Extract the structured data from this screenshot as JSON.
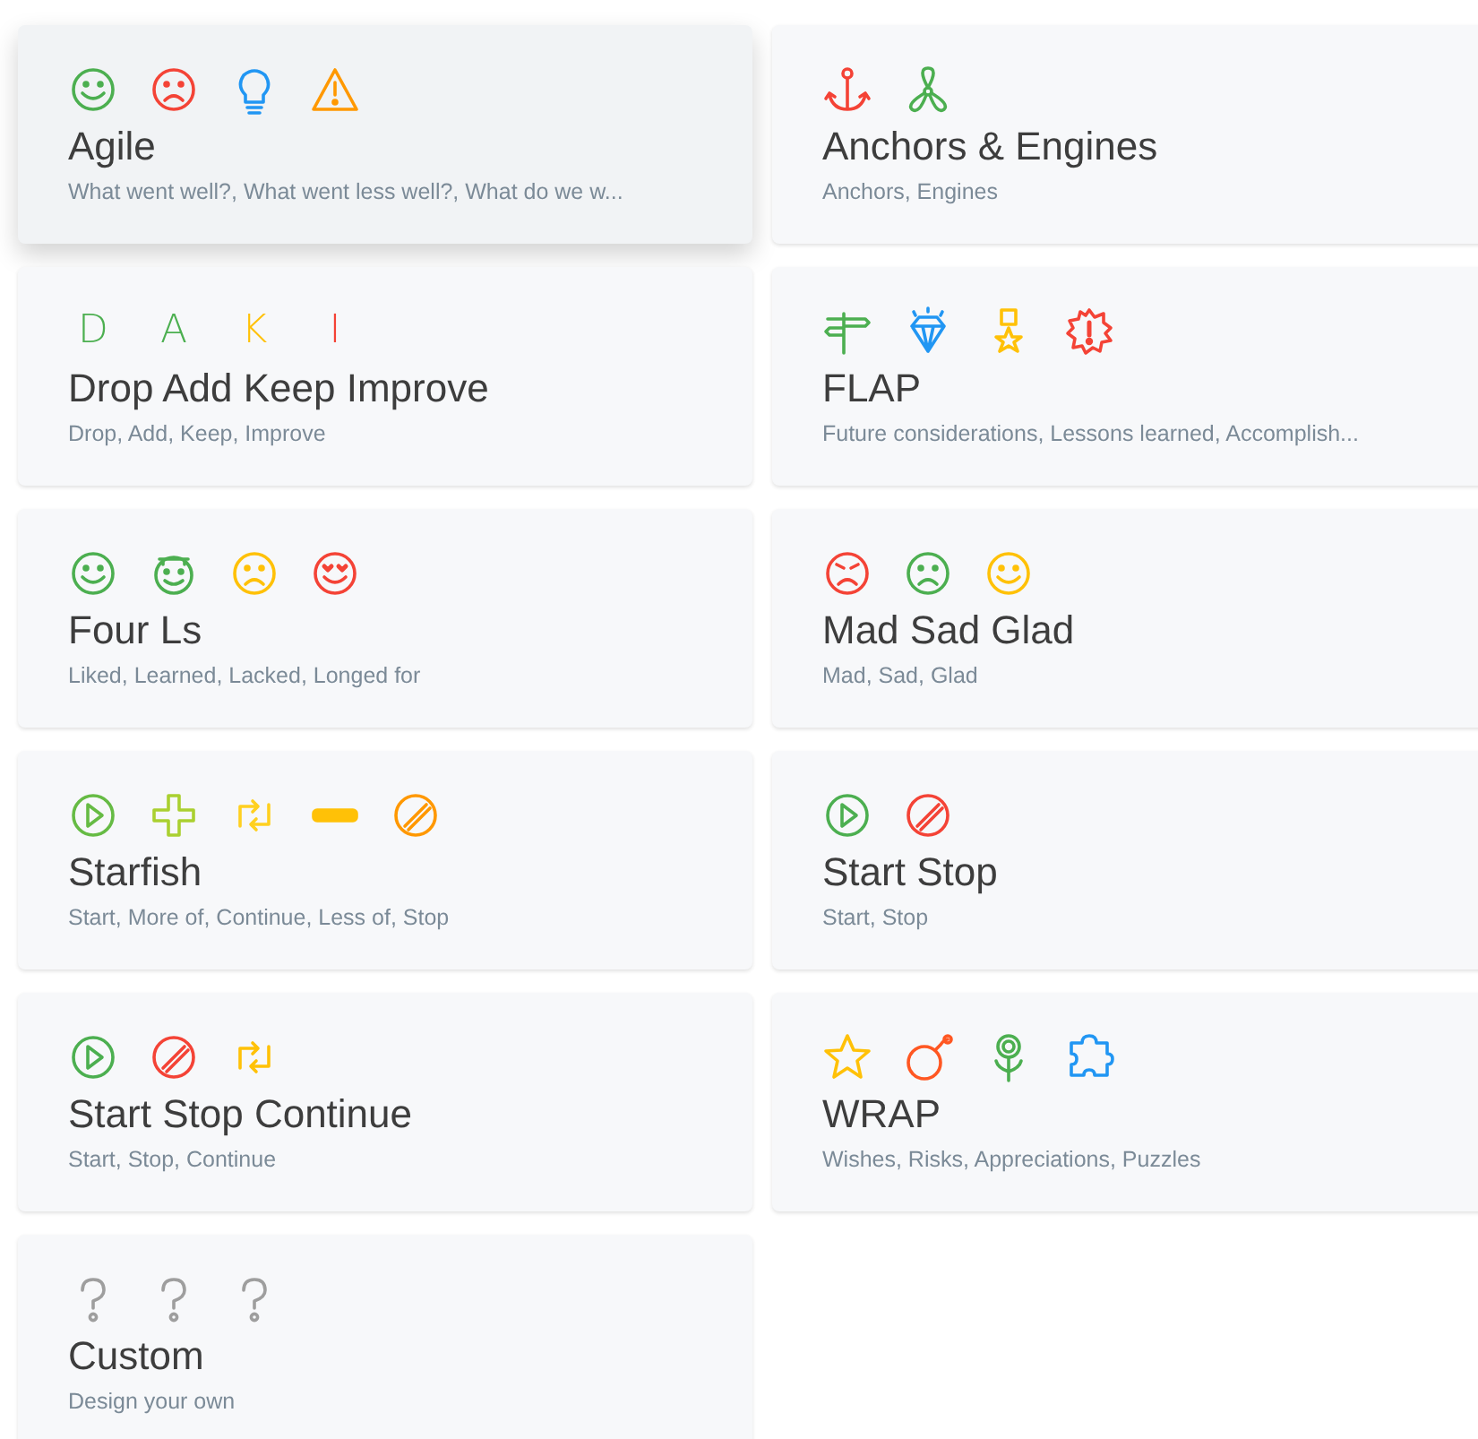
{
  "templates": [
    {
      "title": "Agile",
      "subtitle": "What went well?, What went less well?, What do we w...",
      "selected": true,
      "icons": [
        {
          "kind": "smile",
          "color": "#4caf50"
        },
        {
          "kind": "frown",
          "color": "#f44336"
        },
        {
          "kind": "bulb",
          "color": "#2196f3"
        },
        {
          "kind": "warning",
          "color": "#ff9800"
        }
      ]
    },
    {
      "title": "Anchors & Engines",
      "subtitle": "Anchors, Engines",
      "selected": false,
      "icons": [
        {
          "kind": "anchor",
          "color": "#f44336"
        },
        {
          "kind": "propeller",
          "color": "#4caf50"
        }
      ]
    },
    {
      "title": "Drop Add Keep Improve",
      "subtitle": "Drop, Add, Keep, Improve",
      "selected": false,
      "icons": [
        {
          "kind": "letter",
          "text": "D",
          "color": "#4caf50"
        },
        {
          "kind": "letter",
          "text": "A",
          "color": "#4caf50"
        },
        {
          "kind": "letter",
          "text": "K",
          "color": "#ffc107"
        },
        {
          "kind": "letter",
          "text": "I",
          "color": "#f44336"
        }
      ]
    },
    {
      "title": "FLAP",
      "subtitle": "Future considerations, Lessons learned, Accomplish...",
      "selected": false,
      "icons": [
        {
          "kind": "signpost",
          "color": "#4caf50"
        },
        {
          "kind": "diamond",
          "color": "#2196f3"
        },
        {
          "kind": "medal",
          "color": "#ffc107"
        },
        {
          "kind": "burst",
          "color": "#f44336"
        }
      ]
    },
    {
      "title": "Four Ls",
      "subtitle": "Liked, Learned, Lacked, Longed for",
      "selected": false,
      "icons": [
        {
          "kind": "smile",
          "color": "#4caf50"
        },
        {
          "kind": "graduate",
          "color": "#4caf50"
        },
        {
          "kind": "frown",
          "color": "#ffc107"
        },
        {
          "kind": "heart-eyes",
          "color": "#f44336"
        }
      ]
    },
    {
      "title": "Mad Sad Glad",
      "subtitle": "Mad, Sad, Glad",
      "selected": false,
      "icons": [
        {
          "kind": "angry",
          "color": "#f44336"
        },
        {
          "kind": "frown",
          "color": "#4caf50"
        },
        {
          "kind": "smile",
          "color": "#ffc107"
        }
      ]
    },
    {
      "title": "Starfish",
      "subtitle": "Start, More of, Continue, Less of, Stop",
      "selected": false,
      "icons": [
        {
          "kind": "play",
          "color": "#66bb44"
        },
        {
          "kind": "plus",
          "color": "#aad030"
        },
        {
          "kind": "cycle",
          "color": "#ffd020"
        },
        {
          "kind": "minus",
          "color": "#ffc107"
        },
        {
          "kind": "stop",
          "color": "#ff9800"
        }
      ]
    },
    {
      "title": "Start Stop",
      "subtitle": "Start, Stop",
      "selected": false,
      "icons": [
        {
          "kind": "play",
          "color": "#4caf50"
        },
        {
          "kind": "stop",
          "color": "#f44336"
        }
      ]
    },
    {
      "title": "Start Stop Continue",
      "subtitle": "Start, Stop, Continue",
      "selected": false,
      "icons": [
        {
          "kind": "play",
          "color": "#4caf50"
        },
        {
          "kind": "stop",
          "color": "#f44336"
        },
        {
          "kind": "cycle",
          "color": "#ffc107"
        }
      ]
    },
    {
      "title": "WRAP",
      "subtitle": "Wishes, Risks, Appreciations, Puzzles",
      "selected": false,
      "icons": [
        {
          "kind": "star",
          "color": "#ffc107"
        },
        {
          "kind": "bomb",
          "color": "#ff5722"
        },
        {
          "kind": "flower",
          "color": "#4caf50"
        },
        {
          "kind": "puzzle",
          "color": "#2196f3"
        }
      ]
    },
    {
      "title": "Custom",
      "subtitle": "Design your own",
      "selected": false,
      "icons": [
        {
          "kind": "question",
          "color": "#9e9e9e"
        },
        {
          "kind": "question",
          "color": "#9e9e9e"
        },
        {
          "kind": "question",
          "color": "#9e9e9e"
        }
      ]
    }
  ]
}
